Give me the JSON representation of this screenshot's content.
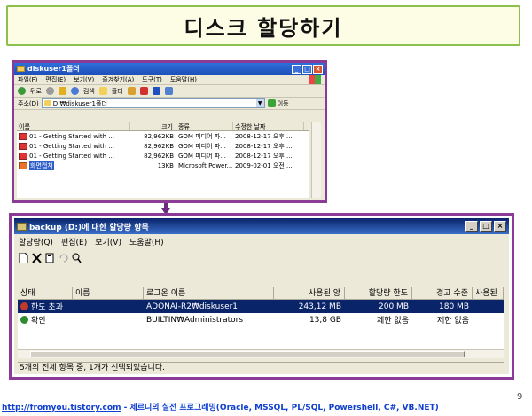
{
  "slide": {
    "title": "디스크 할당하기",
    "page_number": "9",
    "footer_url": "http://fromyou.tistory.com",
    "footer_text": " - 제르니의 실전 프로그래밍(Oracle, MSSQL, PL/SQL, Powershell, C#, VB.NET)"
  },
  "explorer": {
    "title": "diskuser1폴더",
    "menu": [
      "파일(F)",
      "편집(E)",
      "보기(V)",
      "즐겨찾기(A)",
      "도구(T)",
      "도움말(H)"
    ],
    "toolbar": {
      "back": "뒤로",
      "search": "검색",
      "folders": "폴더"
    },
    "address_label": "주소(D)",
    "address_value": "D:₩diskuser1폴더",
    "go_label": "이동",
    "columns": [
      "이름",
      "크기",
      "종류",
      "수정한 날짜"
    ],
    "files": [
      {
        "name": "01 - Getting Started with ...",
        "size": "82,962KB",
        "type": "GOM 미디어 파...",
        "date": "2008-12-17 오후 ..."
      },
      {
        "name": "01 - Getting Started with ...",
        "size": "82,962KB",
        "type": "GOM 미디어 파...",
        "date": "2008-12-17 오후 ..."
      },
      {
        "name": "01 - Getting Started with ...",
        "size": "82,962KB",
        "type": "GOM 미디어 파...",
        "date": "2008-12-17 오후 ..."
      },
      {
        "name": "화면캡쳐",
        "size": "13KB",
        "type": "Microsoft Power...",
        "date": "2009-02-01 오전 ..."
      }
    ]
  },
  "quota": {
    "title": "backup (D:)에 대한 할당량 항목",
    "menu": [
      "할당량(Q)",
      "편집(E)",
      "보기(V)",
      "도움말(H)"
    ],
    "columns": [
      "상태",
      "이름",
      "로그온 이름",
      "사용된 양",
      "할당량 한도",
      "경고 수준",
      "사용된"
    ],
    "entries": [
      {
        "status": "한도 초과",
        "name": "",
        "logon": "ADONAI-R2₩diskuser1",
        "used": "243,12 MB",
        "limit": "200 MB",
        "warn": "180 MB",
        "pct": "",
        "status_color": "#c0392b"
      },
      {
        "status": "확인",
        "name": "",
        "logon": "BUILTIN₩Administrators",
        "used": "13,8 GB",
        "limit": "제한 없음",
        "warn": "제한 없음",
        "pct": "",
        "status_color": "#2e8b2e"
      }
    ],
    "status_bar": "5개의 전체 항목 중, 1개가 선택되었습니다."
  },
  "colors": {
    "accent_border": "#8a3b96",
    "title_border": "#8bc04a",
    "selection": "#0a246a",
    "footer_link": "#1040d0"
  }
}
